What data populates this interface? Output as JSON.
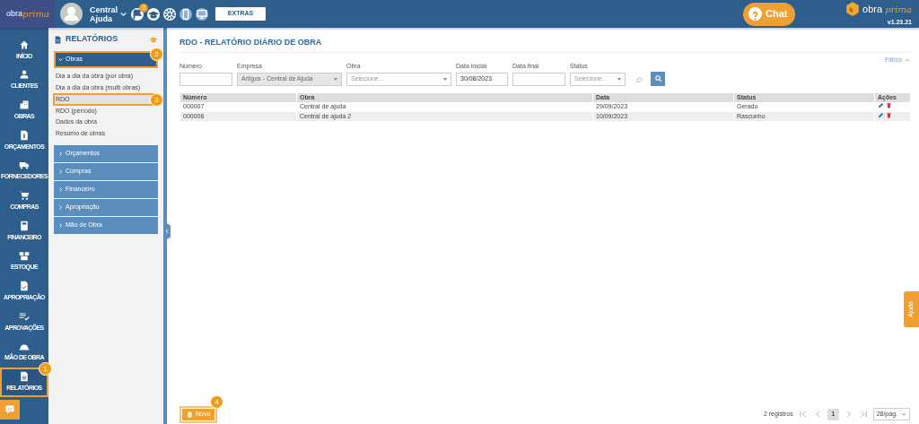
{
  "header": {
    "logo": [
      "obra",
      "prima"
    ],
    "company": [
      "Central",
      "Ajuda"
    ],
    "notification_count": "3",
    "extras_button": "EXTRAS",
    "chat_button": "Chat",
    "brand": [
      "obra",
      "prima"
    ],
    "version": "v1.23.21"
  },
  "rail": [
    {
      "label": "INÍCIO",
      "selected": false
    },
    {
      "label": "CLIENTES",
      "selected": false
    },
    {
      "label": "OBRAS",
      "selected": false
    },
    {
      "label": "ORÇAMENTOS",
      "selected": false
    },
    {
      "label": "FORNECEDORES",
      "selected": false
    },
    {
      "label": "COMPRAS",
      "selected": false
    },
    {
      "label": "FINANCEIRO",
      "selected": false
    },
    {
      "label": "ESTOQUE",
      "selected": false
    },
    {
      "label": "APROPRIAÇÃO",
      "selected": false
    },
    {
      "label": "APROVAÇÕES",
      "selected": false
    },
    {
      "label": "MÃO DE OBRA",
      "selected": false
    },
    {
      "label": "RELATÓRIOS",
      "selected": true,
      "callout": "1"
    }
  ],
  "panel": {
    "title": "RELATÓRIOS",
    "sections": [
      {
        "label": "Obras",
        "expanded": true,
        "callout": "2",
        "items": [
          {
            "label": "Dia a dia da obra (por obra)",
            "selected": false
          },
          {
            "label": "Dia a dia da obra (multi obras)",
            "selected": false
          },
          {
            "label": "RDO",
            "selected": true,
            "callout": "3"
          },
          {
            "label": "RDO (período)",
            "selected": false
          },
          {
            "label": "Dados da obra",
            "selected": false
          },
          {
            "label": "Resumo de obras",
            "selected": false
          }
        ]
      },
      {
        "label": "Orçamentos",
        "expanded": false
      },
      {
        "label": "Compras",
        "expanded": false
      },
      {
        "label": "Financeiro",
        "expanded": false
      },
      {
        "label": "Apropriação",
        "expanded": false
      },
      {
        "label": "Mão de Obra",
        "expanded": false
      }
    ]
  },
  "main": {
    "title": "RDO - RELATÓRIO DIÁRIO DE OBRA",
    "filters_toggle": "Filtros",
    "filters": [
      {
        "label": "Número",
        "kind": "text"
      },
      {
        "label": "Empresa",
        "kind": "select",
        "value": "Artigos - Central de Ajuda",
        "disabled": true
      },
      {
        "label": "Obra",
        "kind": "select",
        "placeholder": "Selecione...",
        "disabled": false
      },
      {
        "label": "Data inicial",
        "kind": "text",
        "value": "30/08/2023"
      },
      {
        "label": "Data final",
        "kind": "text"
      },
      {
        "label": "Status",
        "kind": "select",
        "placeholder": "Selecione...",
        "disabled": false
      }
    ],
    "table": {
      "columns": [
        "Número",
        "Obra",
        "Data",
        "Status",
        "Ações"
      ],
      "rows": [
        [
          "000007",
          "Central de ajuda",
          "29/09/2023",
          "Gerado"
        ],
        [
          "000006",
          "Central de ajuda 2",
          "10/09/2023",
          "Rascunho"
        ]
      ]
    },
    "footer": {
      "new_button": "Novo",
      "callout": "4",
      "records": "2 registros",
      "page": "1",
      "page_size": "28/pág."
    }
  },
  "help_tab": "Ajuda"
}
